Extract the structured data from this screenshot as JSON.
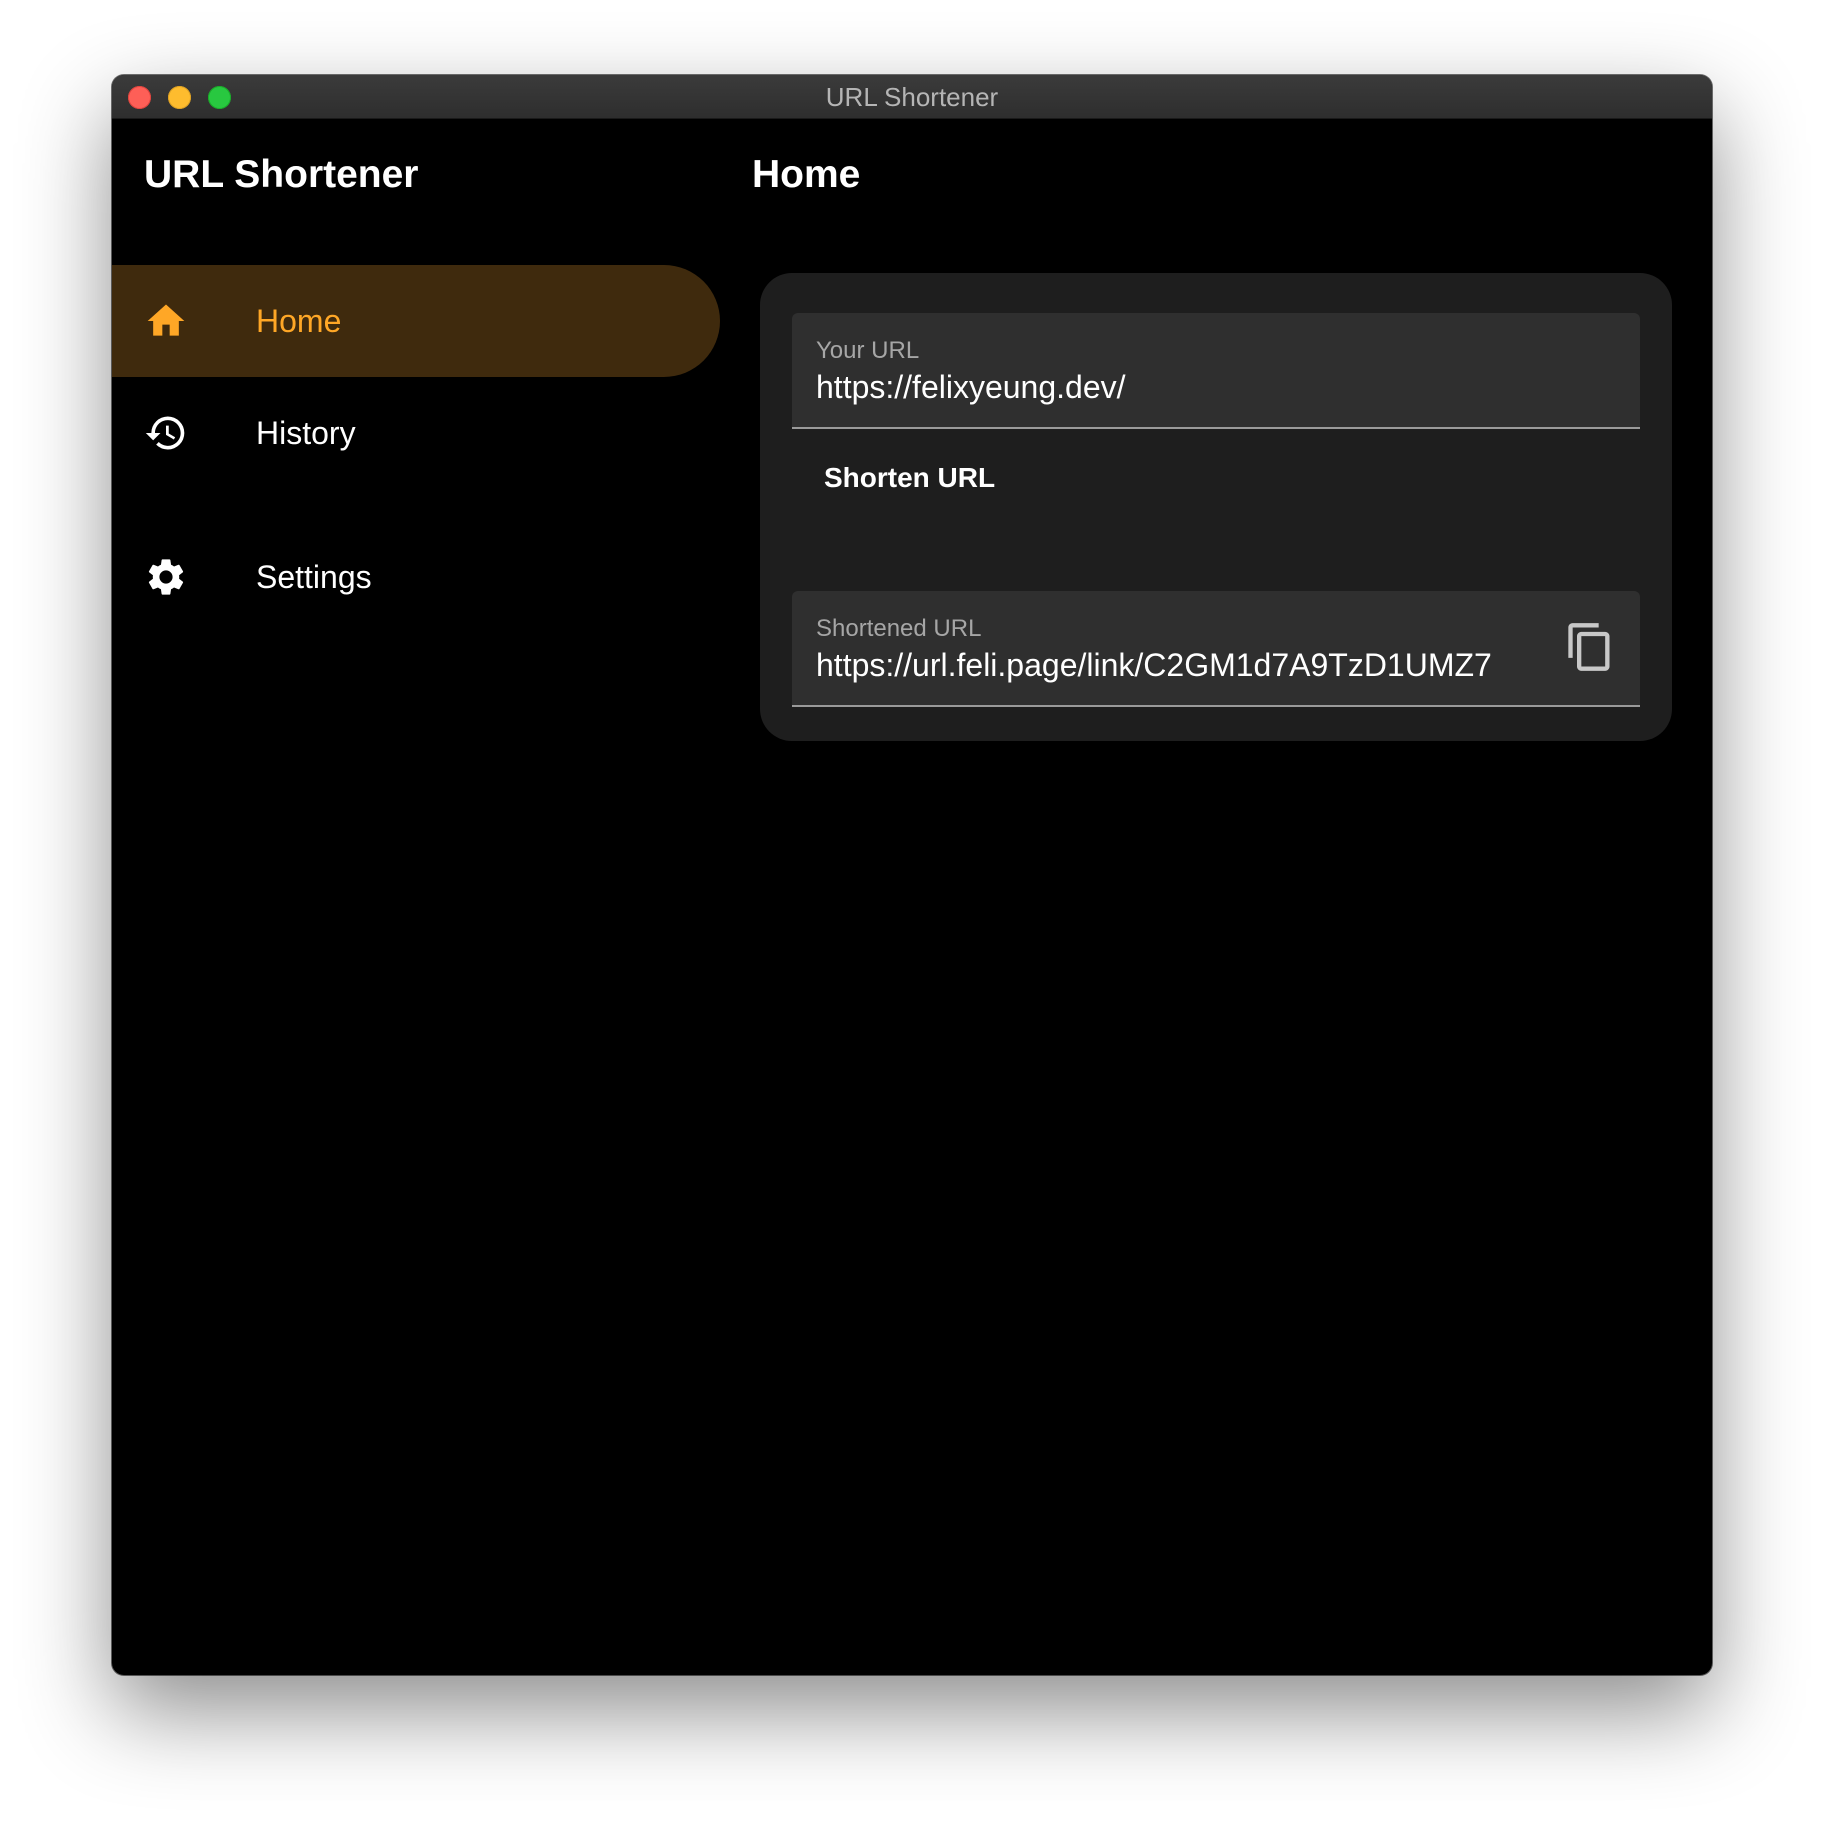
{
  "window": {
    "title": "URL Shortener"
  },
  "sidebar": {
    "app_title": "URL Shortener",
    "items": [
      {
        "label": "Home",
        "icon": "home-icon",
        "selected": true
      },
      {
        "label": "History",
        "icon": "history-icon",
        "selected": false
      },
      {
        "label": "Settings",
        "icon": "settings-icon",
        "selected": false
      }
    ]
  },
  "main": {
    "page_title": "Home",
    "url_input": {
      "label": "Your URL",
      "value": "https://felixyeung.dev/"
    },
    "shorten_button": {
      "label": "Shorten URL"
    },
    "result": {
      "label": "Shortened URL",
      "value": "https://url.feli.page/link/C2GM1d7A9TzD1UMZ7",
      "action_icon": "copy-icon"
    }
  },
  "colors": {
    "accent": "#ffa726",
    "selected_background": "#3f2a0d",
    "window_background": "#000000",
    "card_background": "#1e1e1e",
    "field_background": "#2f2f2f"
  }
}
